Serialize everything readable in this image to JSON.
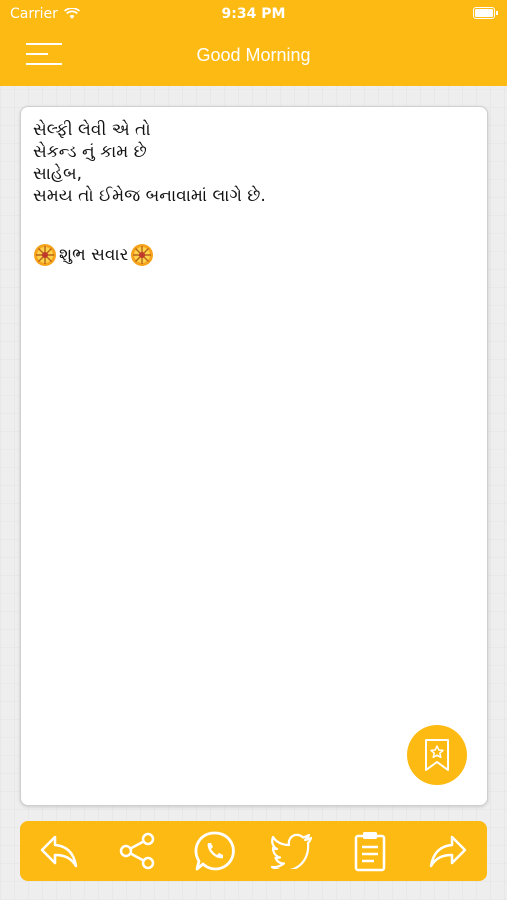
{
  "status_bar": {
    "carrier": "Carrier",
    "time": "9:34 PM"
  },
  "header": {
    "title": "Good Morning",
    "menu_icon": "hamburger-menu-icon"
  },
  "content": {
    "quote": "સેલ્ફી લેવી એ તો\nસેકન્ડ નું કામ છે\nસાહેબ,\nસમય તો ઈમેજ બનાવામાં લાગે છે.",
    "greeting": "શુભ સવાર"
  },
  "actions": [
    {
      "icon": "reply-icon"
    },
    {
      "icon": "share-icon"
    },
    {
      "icon": "whatsapp-icon"
    },
    {
      "icon": "twitter-icon"
    },
    {
      "icon": "clipboard-icon"
    },
    {
      "icon": "forward-icon"
    }
  ],
  "favorite_icon": "bookmark-star-icon",
  "colors": {
    "accent": "#FDBA12",
    "card": "#FFFFFF",
    "text": "#111111"
  }
}
